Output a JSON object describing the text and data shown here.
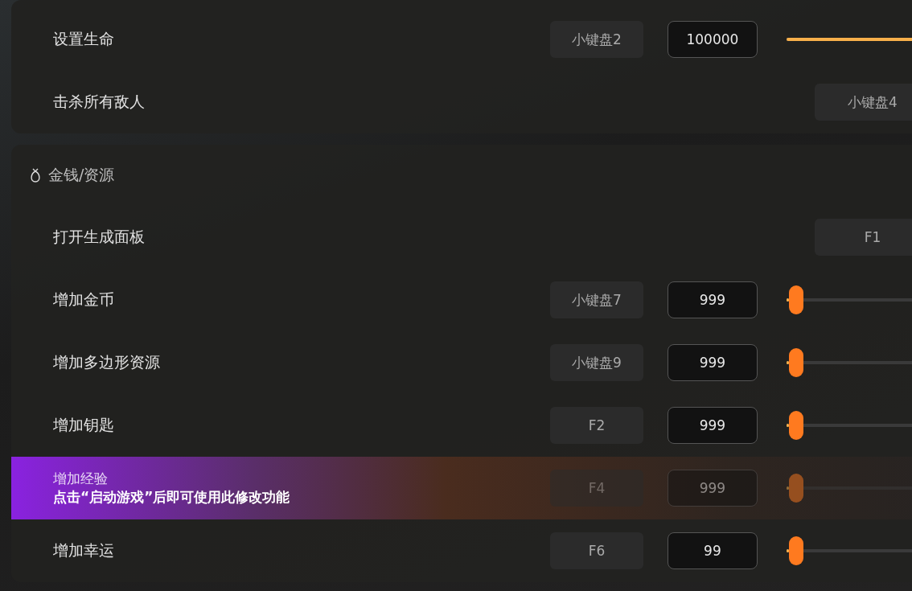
{
  "sections": [
    {
      "rows": [
        {
          "kind": "slider",
          "label": "设置生命",
          "hotkey": "小键盘2",
          "value": "100000"
        },
        {
          "kind": "button",
          "label": "击杀所有敌人",
          "hotkey": "小键盘4"
        }
      ]
    },
    {
      "title": "金钱/资源",
      "rows": [
        {
          "kind": "button",
          "label": "打开生成面板",
          "hotkey": "F1"
        },
        {
          "kind": "slider",
          "label": "增加金币",
          "hotkey": "小键盘7",
          "value": "999",
          "level": 0.04
        },
        {
          "kind": "slider",
          "label": "增加多边形资源",
          "hotkey": "小键盘9",
          "value": "999",
          "level": 0.04
        },
        {
          "kind": "slider",
          "label": "增加钥匙",
          "hotkey": "F2",
          "value": "999",
          "level": 0.04
        },
        {
          "kind": "slider",
          "label": "增加经验",
          "hotkey": "F4",
          "value": "999",
          "level": 0.04,
          "locked": true,
          "notice": "点击“启动游戏”后即可使用此修改功能"
        },
        {
          "kind": "slider",
          "label": "增加幸运",
          "hotkey": "F6",
          "value": "99",
          "level": 0.04
        }
      ]
    }
  ]
}
